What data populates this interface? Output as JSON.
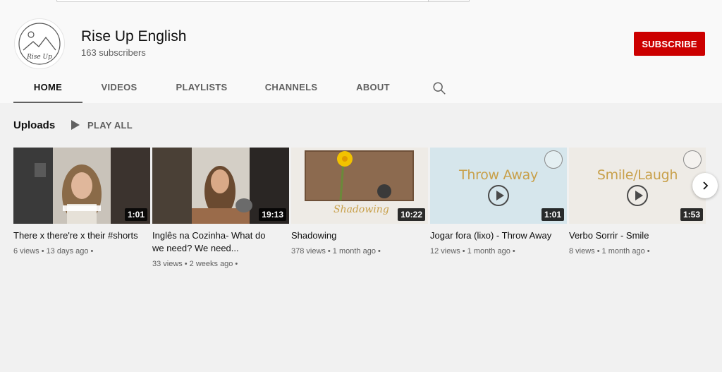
{
  "channel": {
    "name": "Rise Up English",
    "subscribers": "163 subscribers",
    "avatar_text": "Rise Up",
    "subscribe_label": "SUBSCRIBE"
  },
  "tabs": [
    {
      "label": "HOME",
      "active": true
    },
    {
      "label": "VIDEOS",
      "active": false
    },
    {
      "label": "PLAYLISTS",
      "active": false
    },
    {
      "label": "CHANNELS",
      "active": false
    },
    {
      "label": "ABOUT",
      "active": false
    }
  ],
  "section": {
    "title": "Uploads",
    "play_all_label": "PLAY ALL"
  },
  "videos": [
    {
      "title": "There x there're x their #shorts",
      "duration": "1:01",
      "views": "6 views",
      "age": "13 days ago",
      "thumb_text": ""
    },
    {
      "title": "Inglês na Cozinha- What do we need? We need...",
      "duration": "19:13",
      "views": "33 views",
      "age": "2 weeks ago",
      "thumb_text": ""
    },
    {
      "title": "Shadowing",
      "duration": "10:22",
      "views": "378 views",
      "age": "1 month ago",
      "thumb_text": "Shadowing"
    },
    {
      "title": "Jogar fora (lixo) - Throw Away",
      "duration": "1:01",
      "views": "12 views",
      "age": "1 month ago",
      "thumb_text": "Throw Away"
    },
    {
      "title": "Verbo Sorrir - Smile",
      "duration": "1:53",
      "views": "8 views",
      "age": "1 month ago",
      "thumb_text": "Smile/Laugh"
    }
  ],
  "icons": {
    "search": "search-icon",
    "play_all": "play-icon",
    "next": "chevron-right-icon"
  },
  "colors": {
    "subscribe_bg": "#cc0000",
    "thumb_title": "#c8a04a",
    "thumb_light_blue": "#d6e6ec",
    "thumb_beige": "#eeebe6"
  }
}
